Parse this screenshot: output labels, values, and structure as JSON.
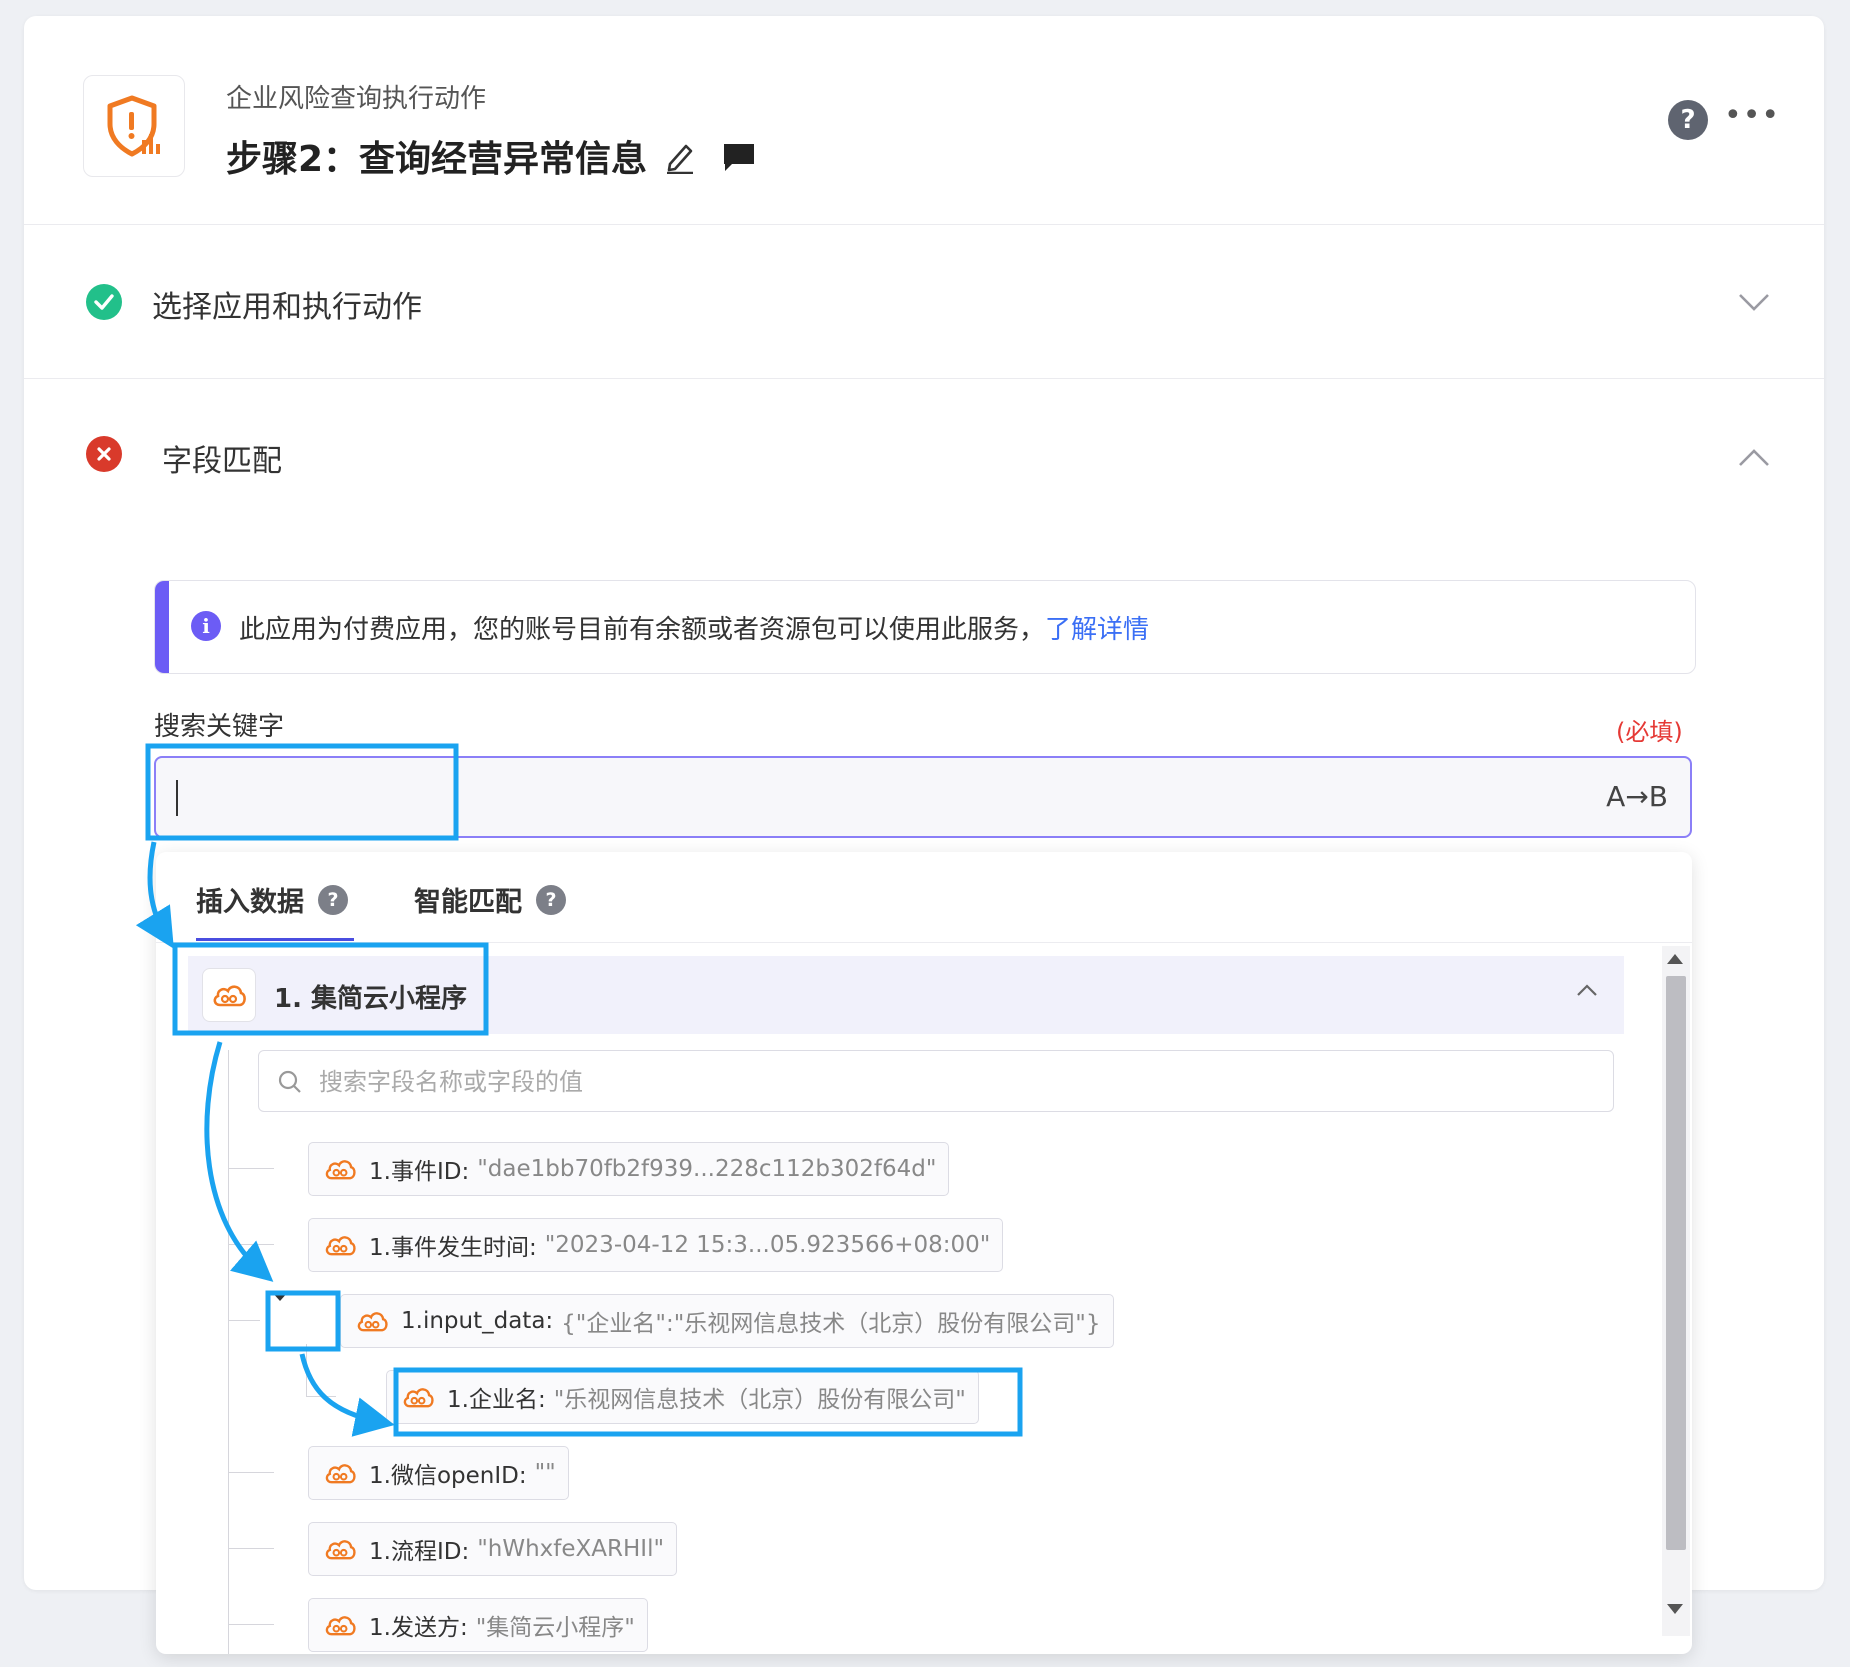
{
  "header": {
    "subtitle": "企业风险查询执行动作",
    "title": "步骤2：查询经营异常信息"
  },
  "sections": {
    "select_app": {
      "label": "选择应用和执行动作",
      "status": "success"
    },
    "field_mapping": {
      "label": "字段匹配",
      "status": "error"
    }
  },
  "notice": {
    "text": "此应用为付费应用，您的账号目前有余额或者资源包可以使用此服务，",
    "link": "了解详情"
  },
  "keyword_field": {
    "label": "搜索关键字",
    "required": "(必填)",
    "value": "",
    "transform_label": "A→B"
  },
  "dropdown": {
    "tabs": [
      {
        "label": "插入数据",
        "active": true
      },
      {
        "label": "智能匹配",
        "active": false
      }
    ],
    "app_row": {
      "label": "1. 集简云小程序",
      "expanded": true
    },
    "search_placeholder": "搜索字段名称或字段的值",
    "fields": [
      {
        "name": "1.事件ID:",
        "value": "\"dae1bb70fb2f939...228c112b302f64d\""
      },
      {
        "name": "1.事件发生时间:",
        "value": "\"2023-04-12 15:3...05.923566+08:00\""
      },
      {
        "name": "1.input_data:",
        "value": "{\"企业名\":\"乐视网信息技术（北京）股份有限公司\"}"
      },
      {
        "name": "1.企业名:",
        "value": "\"乐视网信息技术（北京）股份有限公司\""
      },
      {
        "name": "1.微信openID:",
        "value": "\"\""
      },
      {
        "name": "1.流程ID:",
        "value": "\"hWhxfeXARHIl\""
      },
      {
        "name": "1.发送方:",
        "value": "\"集简云小程序\""
      }
    ]
  },
  "colors": {
    "accent": "#6c5cf5",
    "brand_orange": "#f07a22",
    "success": "#22c08a",
    "error": "#d93a2b",
    "annotation": "#1aa3f0"
  }
}
